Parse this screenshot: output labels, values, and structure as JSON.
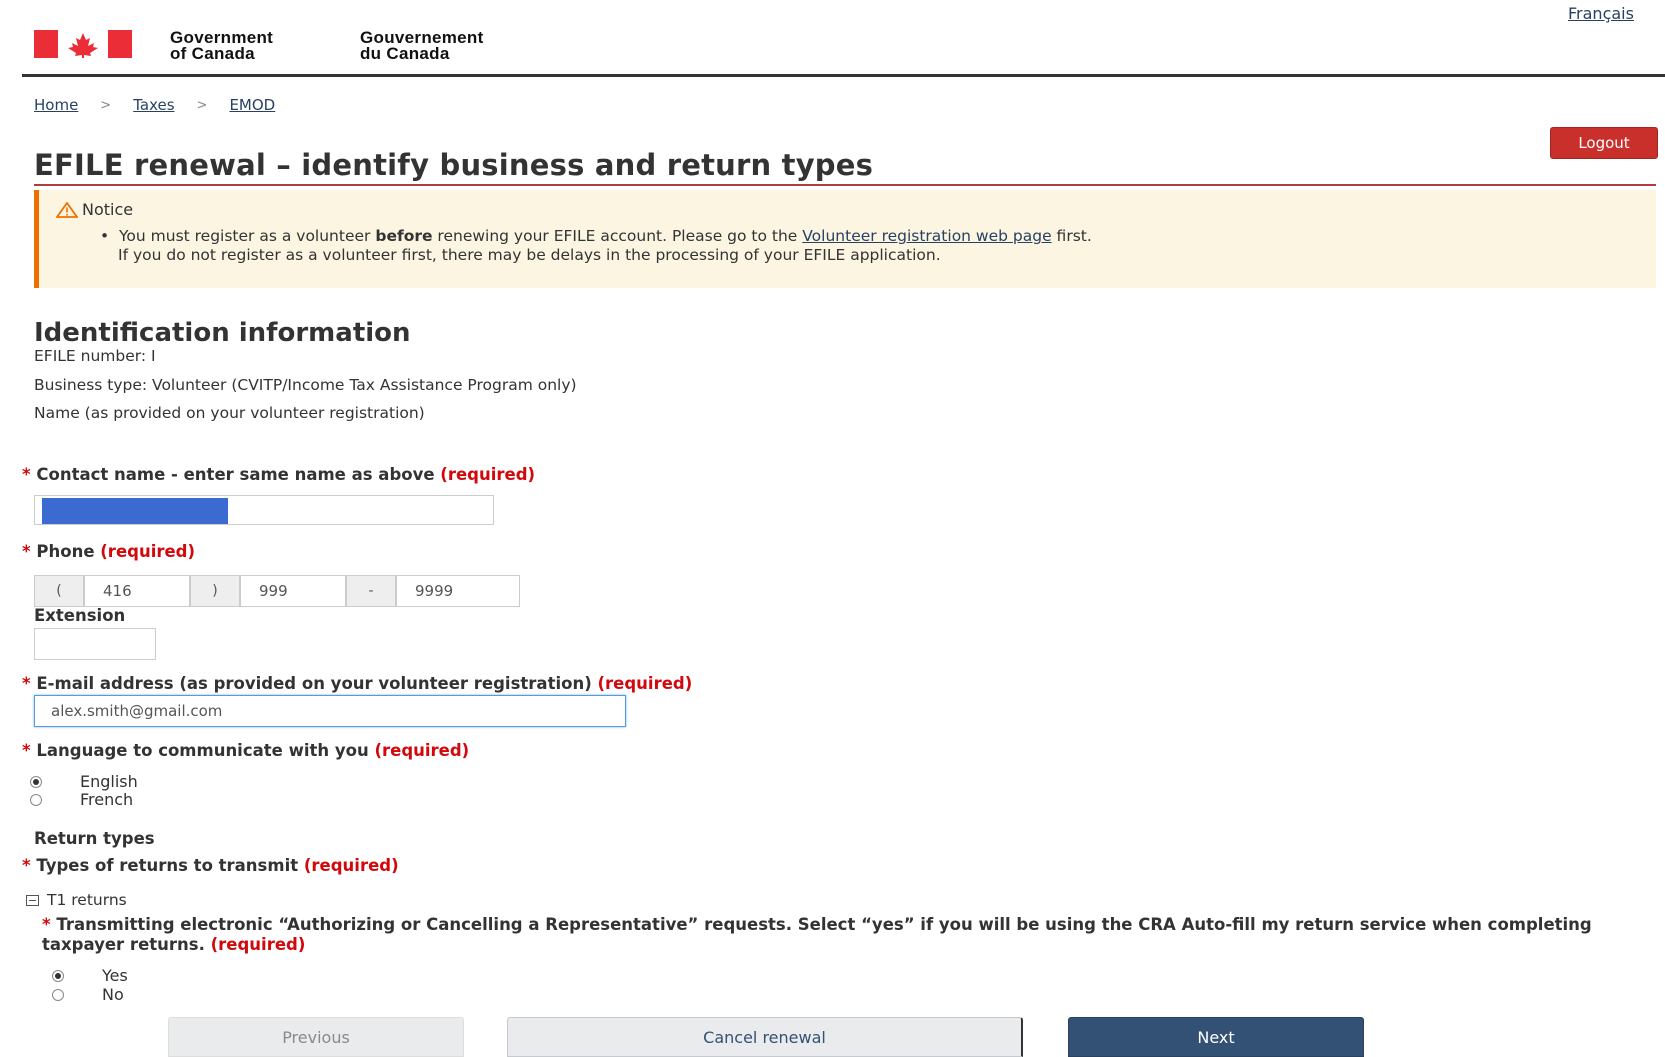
{
  "header": {
    "lang_link": "Français",
    "sig_en_line1": "Government",
    "sig_en_line2": "of Canada",
    "sig_fr_line1": "Gouvernement",
    "sig_fr_line2": "du Canada",
    "flag_colors": {
      "red": "#eb2d37"
    }
  },
  "breadcrumb": [
    "Home",
    "Taxes",
    "EMOD"
  ],
  "logout_label": "Logout",
  "page_title": "EFILE renewal – identify business and return types",
  "notice": {
    "heading": "Notice",
    "line1_pre": "You must register as a volunteer ",
    "line1_bold": "before",
    "line1_mid": " renewing your EFILE account. Please go to the ",
    "line1_link": "Volunteer registration web page",
    "line1_post": " first.",
    "line2": "If you do not register as a volunteer first, there may be delays in the processing of your EFILE application."
  },
  "identification": {
    "heading": "Identification information",
    "efile_number": "EFILE number: I",
    "business_type": "Business type: Volunteer (CVITP/Income Tax Assistance Program only)",
    "name_note": "Name (as provided on your volunteer registration)"
  },
  "form": {
    "required_text": "(required)",
    "contact_label": "Contact name - enter same name as above",
    "phone_label": "Phone",
    "phone": {
      "open": "(",
      "area": "416",
      "close": ")",
      "prefix": "999",
      "dash": "-",
      "line": "9999"
    },
    "extension_label": "Extension",
    "email_label": "E-mail address (as provided on your volunteer registration)",
    "email_value": "alex.smith@gmail.com",
    "language_label": "Language to communicate with you",
    "language_options": [
      "English",
      "French"
    ],
    "language_selected": "English",
    "return_types_heading": "Return types",
    "types_label": "Types of returns to transmit",
    "t1_returns": "T1 returns",
    "auth_question": "Transmitting electronic “Authorizing or Cancelling a Representative” requests. Select “yes” if you will be using the CRA Auto-fill my return service when completing taxpayer returns.",
    "auth_options": [
      "Yes",
      "No"
    ],
    "auth_selected": "Yes"
  },
  "buttons": {
    "previous": "Previous",
    "cancel": "Cancel renewal",
    "next": "Next"
  }
}
